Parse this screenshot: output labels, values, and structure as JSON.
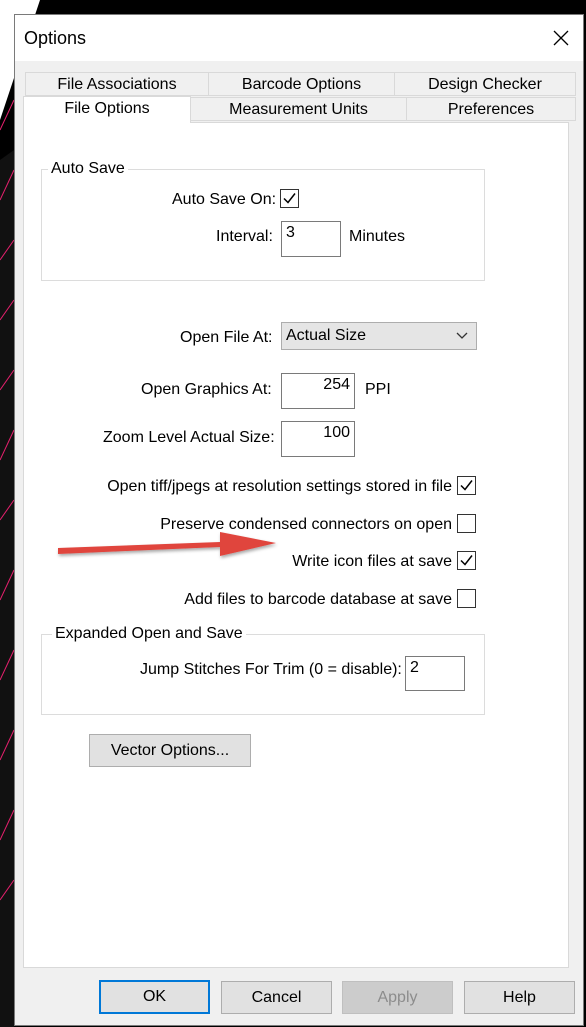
{
  "window": {
    "title": "Options"
  },
  "tabs": {
    "row1": [
      "File Associations",
      "Barcode Options",
      "Design Checker"
    ],
    "row2": [
      "File Options",
      "Measurement Units",
      "Preferences"
    ],
    "active": "File Options"
  },
  "auto_save": {
    "legend": "Auto Save",
    "on_label": "Auto Save On:",
    "on_checked": true,
    "interval_label": "Interval:",
    "interval_value": "3",
    "interval_unit": "Minutes"
  },
  "open_file_at": {
    "label": "Open File At:",
    "value": "Actual Size"
  },
  "open_graphics_at": {
    "label": "Open Graphics At:",
    "value": "254",
    "unit": "PPI"
  },
  "zoom_level": {
    "label": "Zoom Level Actual Size:",
    "value": "100"
  },
  "options": [
    {
      "label": "Open tiff/jpegs at resolution settings stored in file",
      "checked": true
    },
    {
      "label": "Preserve condensed connectors on open",
      "checked": false
    },
    {
      "label": "Write icon files at save",
      "checked": true
    },
    {
      "label": "Add files to barcode database at save",
      "checked": false
    }
  ],
  "expanded": {
    "legend": "Expanded Open and Save",
    "jump_label": "Jump Stitches For Trim (0 = disable):",
    "jump_value": "2"
  },
  "vector_options_label": "Vector Options...",
  "buttons": {
    "ok": "OK",
    "cancel": "Cancel",
    "apply": "Apply",
    "help": "Help"
  },
  "colors": {
    "accent": "#0078d7",
    "annotation_arrow": "#e0443e",
    "background_lines": "#e6206e"
  },
  "icons": {
    "close": "close-icon",
    "checkmark": "checkmark-icon",
    "dropdown": "chevron-down-icon",
    "annotation": "arrow-right-icon"
  }
}
